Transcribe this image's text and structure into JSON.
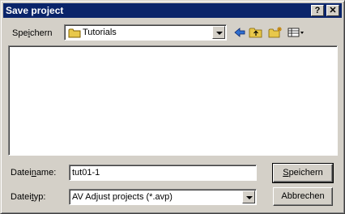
{
  "title": "Save project",
  "title_buttons": {
    "help": "?",
    "close": "✕"
  },
  "save_in": {
    "label_pre": "Spe",
    "label_key": "i",
    "label_post": "chern",
    "folder": "Tutorials"
  },
  "filename": {
    "label_pre": "Datei",
    "label_key": "n",
    "label_post": "ame:",
    "value": "tut01-1"
  },
  "filetype": {
    "label_pre": "Datei",
    "label_key": "t",
    "label_post": "yp:",
    "value": "AV Adjust projects (*.avp)"
  },
  "buttons": {
    "save_key": "S",
    "save_rest": "peichern",
    "cancel": "Abbrechen"
  },
  "colors": {
    "titlebar": "#0a246a",
    "folder": "#e8c84a"
  },
  "icons": [
    "help-icon",
    "close-icon",
    "folder-icon",
    "back-arrow-icon",
    "up-folder-icon",
    "new-folder-icon",
    "view-menu-icon"
  ]
}
